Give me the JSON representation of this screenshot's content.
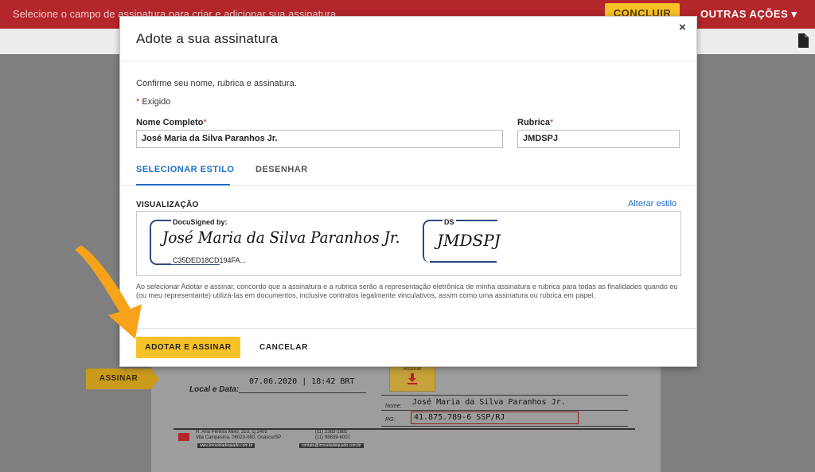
{
  "banner": {
    "message": "Selecione o campo de assinatura para criar e adicionar sua assinatura",
    "finish_label": "CONCLUIR",
    "other_actions_label": "OUTRAS AÇÕES ▾"
  },
  "document": {
    "sign_tag_label": "ASSINAR",
    "sign_box_label": "Assinar",
    "local_date_label": "Local e Data:",
    "date_value": "07.06.2020 | 18:42 BRT",
    "name_label": "Nome:",
    "name_value": "José Maria da Silva Paranhos Jr.",
    "rg_label": "RG:",
    "rg_value": "41.875.789-6 SSP/RJ",
    "footer_address_1": "R. Ana Pereira Melo, 253, cj.1405",
    "footer_address_2": "Vila Campesina, 06023-080, Osasco/SP",
    "footer_phone_1": "(11) 2383-1885",
    "footer_phone_2": "(11) 98839-6007",
    "footer_site": "www.imovieladequado.com.br",
    "footer_email": "contato@imoveladequado.com.br"
  },
  "modal": {
    "title": "Adote a sua assinatura",
    "close_label": "×",
    "confirm_text": "Confirme seu nome, rubrica e assinatura.",
    "required_marker": "*",
    "required_text": " Exigido",
    "full_name_label": "Nome Completo",
    "full_name_value": "José Maria da Silva Paranhos Jr.",
    "initials_label": "Rubrica",
    "initials_value": "JMDSPJ",
    "tabs": [
      "SELECIONAR ESTILO",
      "DESENHAR"
    ],
    "preview_label": "VISUALIZAÇÃO",
    "change_style_link": "Alterar estilo",
    "docusigned_label": "DocuSigned by:",
    "signature_text": "José Maria da Silva Paranhos Jr.",
    "hash_text": "C35DED18CD194FA...",
    "ds_label": "DS",
    "initials_signature": "JMDSPJ",
    "legal_text": "Ao selecionar Adotar e assinar, concordo que a assinatura e a rubrica serão a representação eletrônica de minha assinatura e rubrica para todas as finalidades quando eu (ou meu representante) utilizá-las em documentos, inclusive contratos legalmente vinculativos, assim como uma assinatura ou rubrica em papel.",
    "adopt_button": "ADOTAR E ASSINAR",
    "cancel_button": "CANCELAR"
  },
  "colors": {
    "banner": "#b3262a",
    "accent_yellow": "#f6c228",
    "link_blue": "#1f6fc7",
    "arrow_orange": "#f7a21b"
  }
}
